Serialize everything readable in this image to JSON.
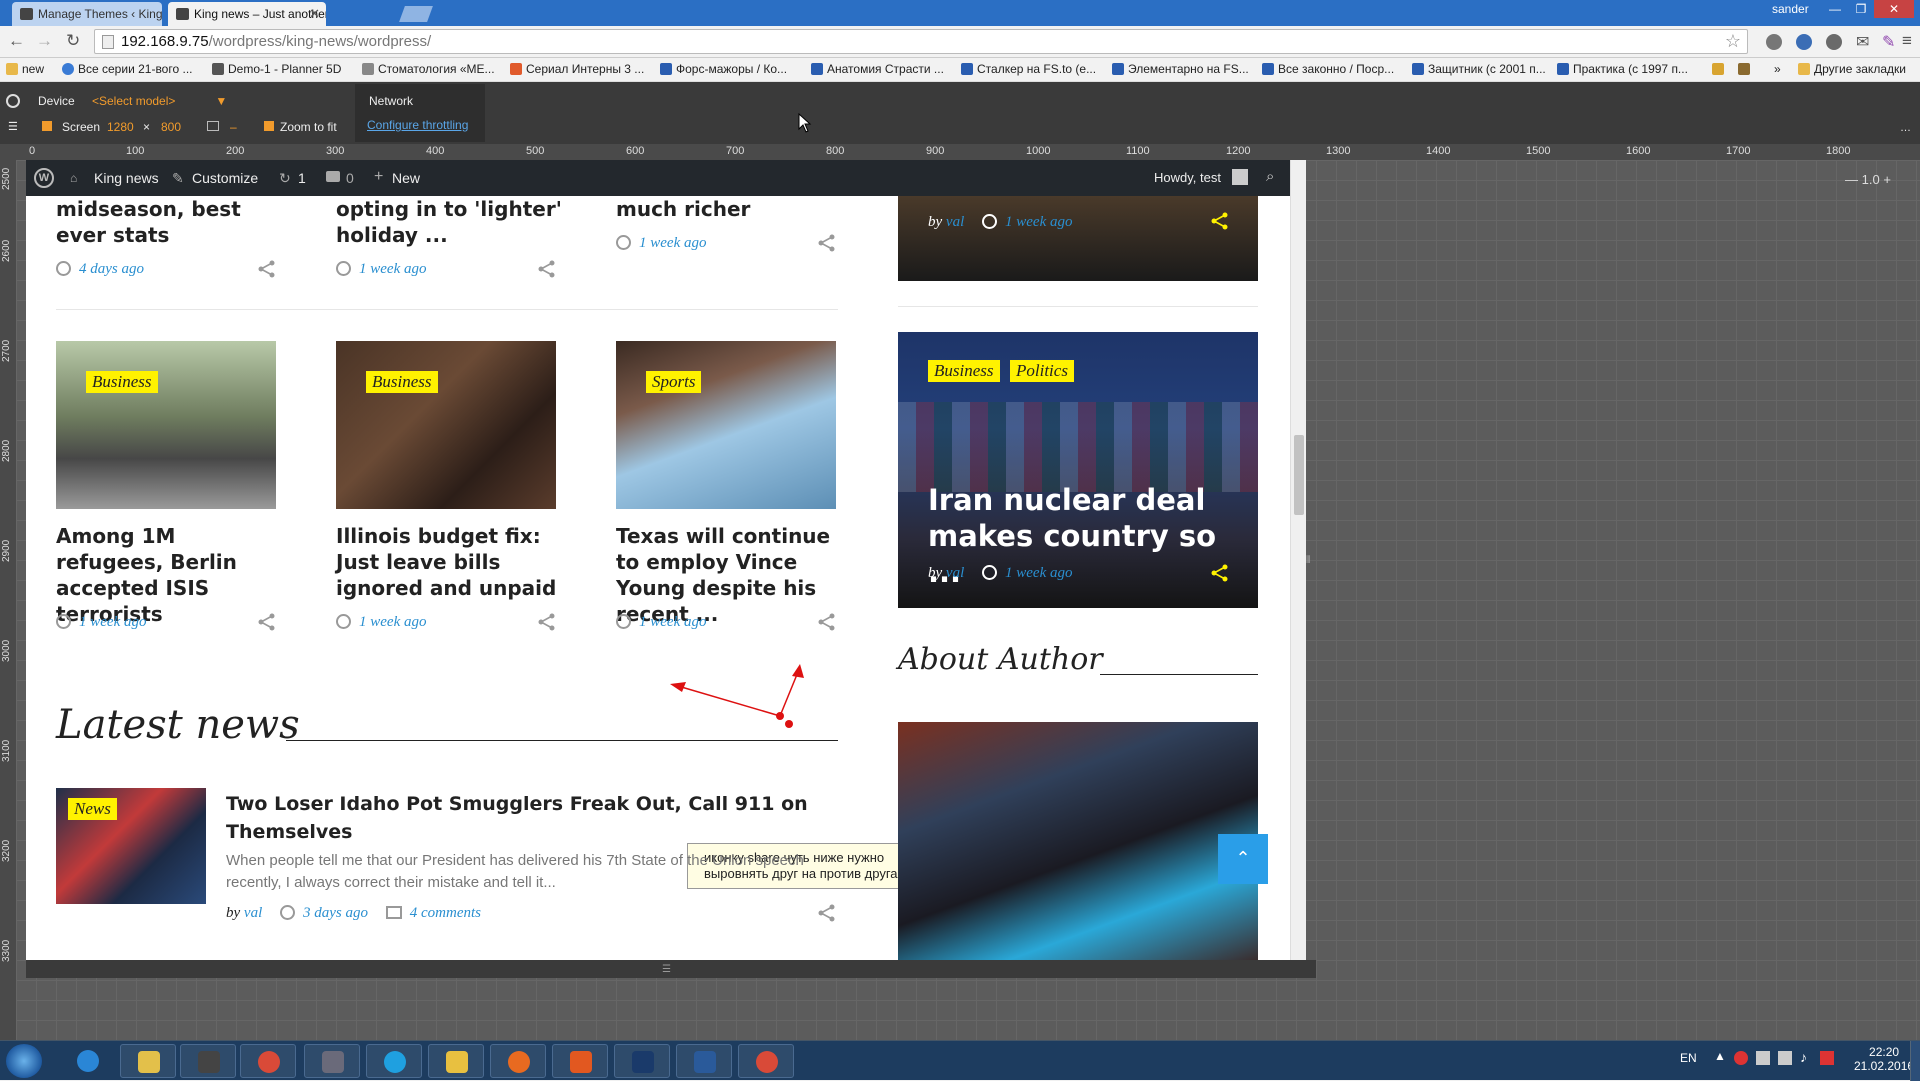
{
  "browser": {
    "tabs": [
      {
        "label": "Manage Themes ‹ King ne"
      },
      {
        "label": "King news – Just another W"
      }
    ],
    "user": "sander",
    "url_host": "192.168.9.75",
    "url_path": "/wordpress/king-news/wordpress/",
    "bookmarks": [
      "new",
      "Все серии 21-вого ...",
      "Demo-1 - Planner 5D",
      "Стоматология «МЕ...",
      "Сериал Интерны 3 ...",
      "Форс-мажоры / Ко...",
      "Анатомия Страсти ...",
      "Сталкер на FS.to (е...",
      "Элементарно на FS...",
      "Все законно / Поср...",
      "Защитник (с 2001 п...",
      "Практика (с 1997 п...",
      "»",
      "Другие закладки"
    ]
  },
  "devtools": {
    "device_label": "Device",
    "model_select": "<Select model>",
    "network_label": "Network",
    "screen_label": "Screen",
    "screen_w": "1280",
    "times": "×",
    "screen_h": "800",
    "dash": "–",
    "zoom_to_fit": "Zoom to fit",
    "configure_throttling": "Configure throttling",
    "zoom_value": "1.0",
    "ruler_h": [
      "0",
      "100",
      "200",
      "300",
      "400",
      "500",
      "600",
      "700",
      "800",
      "900",
      "1000",
      "1100",
      "1200",
      "1300",
      "1400",
      "1500",
      "1600",
      "1700",
      "1800"
    ],
    "ruler_v": [
      "2500",
      "2600",
      "2700",
      "2800",
      "2900",
      "3000",
      "3100",
      "3200",
      "3300"
    ]
  },
  "admin_bar": {
    "site": "King news",
    "customize": "Customize",
    "updates": "1",
    "comments": "0",
    "new": "New",
    "howdy": "Howdy, test"
  },
  "top_row": [
    {
      "title": "midseason, best ever stats",
      "date": "4 days ago"
    },
    {
      "title": "opting in to 'lighter' holiday ...",
      "date": "1 week ago"
    },
    {
      "title": "much richer",
      "date": "1 week ago"
    }
  ],
  "cards": [
    {
      "category": "Business",
      "title": "Among 1M refugees, Berlin accepted ISIS terrorists",
      "date": "1 week ago"
    },
    {
      "category": "Business",
      "title": "Illinois budget fix: Just leave bills ignored and unpaid",
      "date": "1 week ago"
    },
    {
      "category": "Sports",
      "title": "Texas will continue to employ Vince Young despite his recent ...",
      "date": "1 week ago"
    }
  ],
  "sidebar": {
    "top_meta": {
      "by": "by",
      "author": "val",
      "date": "1 week ago"
    },
    "featured": {
      "categories": [
        "Business",
        "Politics"
      ],
      "title": "Iran nuclear deal makes country so ...",
      "by": "by",
      "author": "val",
      "date": "1 week ago"
    },
    "about_heading": "About Author"
  },
  "annotation_note": "иконку share чуть ниже нужно выровнять друг на против друга",
  "latest": {
    "heading": "Latest news",
    "item": {
      "category": "News",
      "title": "Two Loser Idaho Pot Smugglers Freak Out, Call 911 on Themselves",
      "excerpt": "When people tell me that our President has delivered his 7th State of the Union speech recently, I always correct their mistake and tell it...",
      "by": "by",
      "author": "val",
      "date": "3 days ago",
      "comments": "4 comments"
    }
  },
  "taskbar": {
    "lang": "EN",
    "time": "22:20",
    "date": "21.02.2016"
  },
  "colors": {
    "accent": "#2a8fd0",
    "category_bg": "#fff200",
    "share_sidebar": "#fff200",
    "admin_bar": "#23282d"
  }
}
